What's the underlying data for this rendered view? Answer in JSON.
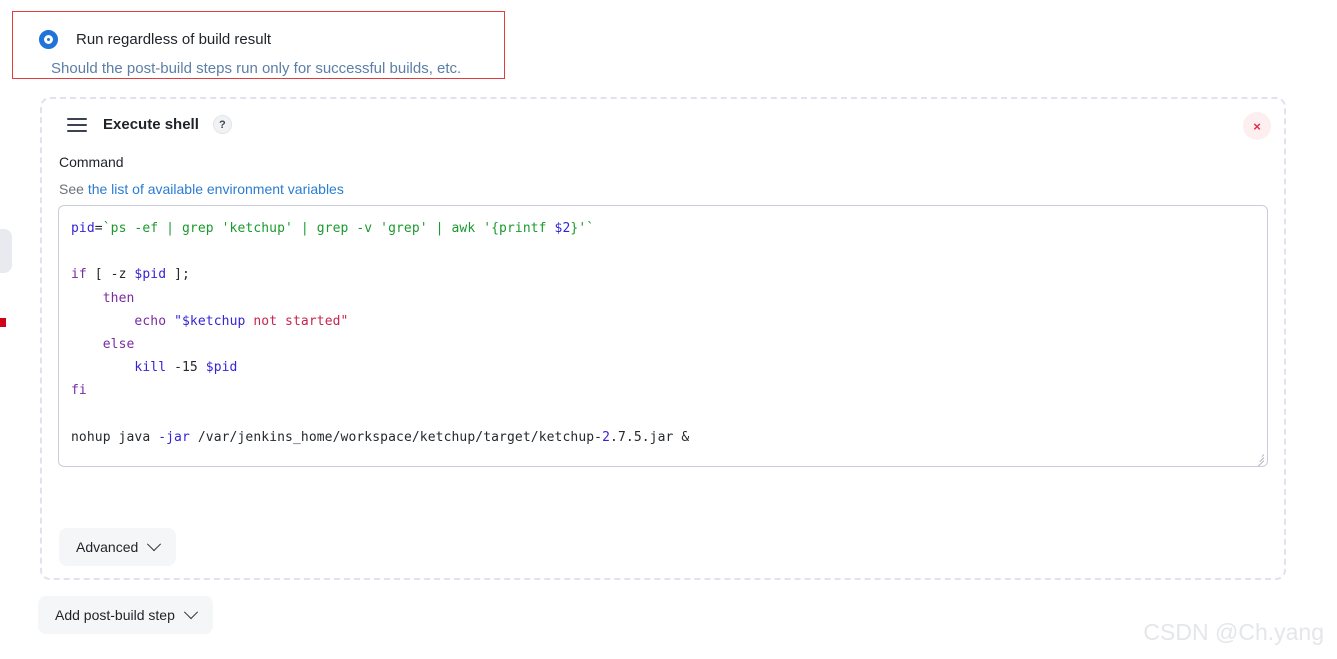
{
  "post_build_trigger": {
    "radio_label": "Run regardless of build result",
    "radio_description": "Should the post-build steps run only for successful builds, etc.",
    "selected": true,
    "border_color": "#e23c3c",
    "accent_color": "#1f73d9"
  },
  "step": {
    "drag_handle_icon": "hamburger-drag-icon",
    "title": "Execute shell",
    "help_icon": "?",
    "close_icon": "×",
    "close_color": "#e02f45",
    "field_label": "Command",
    "env_prefix": "See ",
    "env_link": "the list of available environment variables",
    "link_color": "#2b7cd3",
    "advanced_button": "Advanced",
    "chevron_icon": "chevron-down-icon"
  },
  "command": {
    "value": "pid=`ps -ef | grep 'ketchup' | grep -v 'grep' | awk '{printf $2}'`\n\nif [ -z $pid ];\n    then\n        echo \"$ketchup not started\"\n    else\n        kill -15 $pid\nfi\n\nnohup java -jar /var/jenkins_home/workspace/ketchup/target/ketchup-2.7.5.jar &",
    "lines": [
      [
        {
          "t": "pid",
          "c": "var"
        },
        {
          "t": "=",
          "c": "plain"
        },
        {
          "t": "`ps -ef | grep 'ketchup' | grep -v 'grep' | awk '{printf ",
          "c": "str"
        },
        {
          "t": "$2",
          "c": "blue"
        },
        {
          "t": "}'`",
          "c": "str"
        }
      ],
      [],
      [
        {
          "t": "if",
          "c": "kw"
        },
        {
          "t": " [ -z ",
          "c": "plain"
        },
        {
          "t": "$pid",
          "c": "var"
        },
        {
          "t": " ];",
          "c": "plain"
        }
      ],
      [
        {
          "t": "    ",
          "c": "plain"
        },
        {
          "t": "then",
          "c": "kw"
        }
      ],
      [
        {
          "t": "        ",
          "c": "plain"
        },
        {
          "t": "echo",
          "c": "kw"
        },
        {
          "t": " ",
          "c": "plain"
        },
        {
          "t": "\"$ketchup",
          "c": "var"
        },
        {
          "t": " not started\"",
          "c": "dq"
        }
      ],
      [
        {
          "t": "    ",
          "c": "plain"
        },
        {
          "t": "else",
          "c": "kw"
        }
      ],
      [
        {
          "t": "        ",
          "c": "plain"
        },
        {
          "t": "kill",
          "c": "var"
        },
        {
          "t": " -15 ",
          "c": "plain"
        },
        {
          "t": "$pid",
          "c": "var"
        }
      ],
      [
        {
          "t": "fi",
          "c": "kw"
        }
      ],
      [],
      [
        {
          "t": "nohup java ",
          "c": "plain"
        },
        {
          "t": "-jar",
          "c": "blue"
        },
        {
          "t": " /var/jenkins_home/workspace/ketchup/target/ketchup-",
          "c": "plain"
        },
        {
          "t": "2",
          "c": "blue"
        },
        {
          "t": ".7.5.jar &",
          "c": "plain"
        }
      ]
    ]
  },
  "footer": {
    "add_step_button": "Add post-build step",
    "chevron_icon": "chevron-down-icon"
  },
  "watermark": {
    "text": "CSDN @Ch.yang"
  }
}
